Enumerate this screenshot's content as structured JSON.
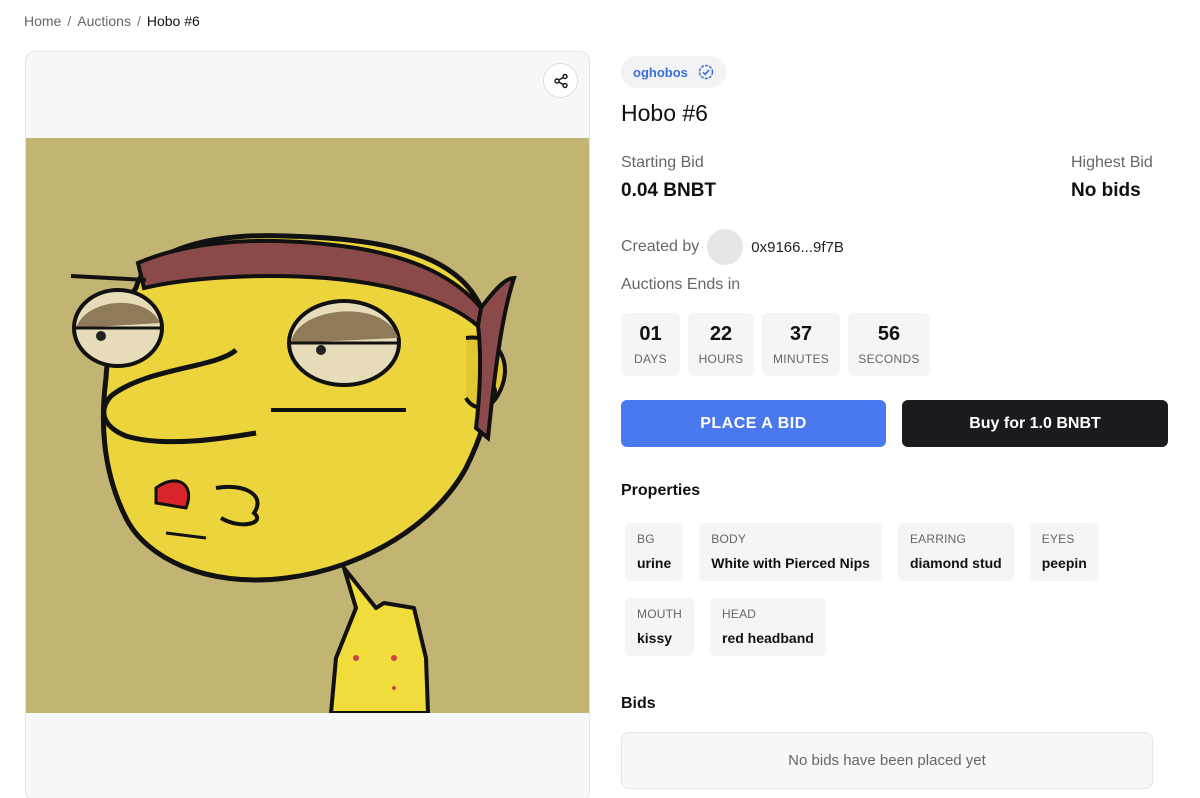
{
  "breadcrumb": {
    "home": "Home",
    "auctions": "Auctions",
    "current": "Hobo #6",
    "separator": "/"
  },
  "media": {
    "share_icon": "share-icon",
    "art_description_icon": "nft-artwork"
  },
  "creator_chip": {
    "name": "oghobos",
    "verified_icon": "verified-check-icon"
  },
  "title": "Hobo #6",
  "starting_bid": {
    "label": "Starting Bid",
    "value": "0.04 BNBT"
  },
  "highest_bid": {
    "label": "Highest Bid",
    "value": "No bids"
  },
  "created_by": {
    "label": "Created by",
    "address": "0x9166...9f7B"
  },
  "auction_ends": {
    "label": "Auctions Ends in",
    "days": "01",
    "days_label": "DAYS",
    "hours": "22",
    "hours_label": "HOURS",
    "minutes": "37",
    "minutes_label": "MINUTES",
    "seconds": "56",
    "seconds_label": "SECONDS"
  },
  "actions": {
    "place_bid": "PLACE A BID",
    "buy": "Buy for 1.0 BNBT"
  },
  "properties": {
    "title": "Properties",
    "items": [
      {
        "key": "BG",
        "value": "urine"
      },
      {
        "key": "BODY",
        "value": "White with Pierced Nips"
      },
      {
        "key": "EARRING",
        "value": "diamond stud"
      },
      {
        "key": "EYES",
        "value": "peepin"
      },
      {
        "key": "MOUTH",
        "value": "kissy"
      },
      {
        "key": "HEAD",
        "value": "red headband"
      }
    ]
  },
  "bids": {
    "title": "Bids",
    "empty_text": "No bids have been placed yet"
  },
  "colors": {
    "accent_blue": "#4a78ee",
    "dark_button": "#1a1b1e",
    "art_background": "#c2b473",
    "face_yellow": "#ecd43c",
    "headband": "#8b4a4a"
  }
}
